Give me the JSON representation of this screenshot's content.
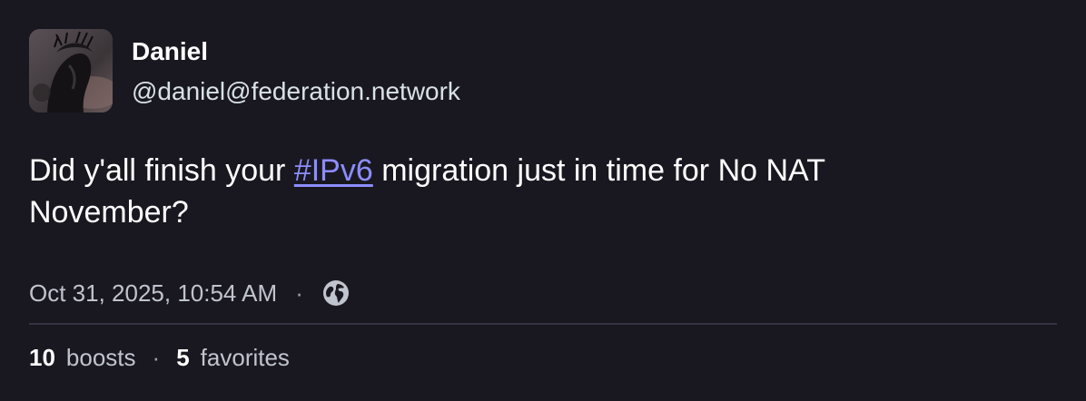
{
  "author": {
    "display_name": "Daniel",
    "handle": "@daniel@federation.network",
    "avatar_icon": "avatar-portrait"
  },
  "post": {
    "text_before": "Did y'all finish your ",
    "hashtag": "#IPv6",
    "text_after": " migration just in time for No NAT November?"
  },
  "meta": {
    "timestamp": "Oct 31, 2025, 10:54 AM",
    "separator": "·",
    "visibility_icon": "globe-icon"
  },
  "stats": {
    "boosts_count": "10",
    "boosts_label": "boosts",
    "separator": "·",
    "favorites_count": "5",
    "favorites_label": "favorites"
  },
  "colors": {
    "background": "#191820",
    "hashtag": "#8c8dff",
    "muted_text": "#c0c4cf",
    "divider": "#34333f"
  }
}
